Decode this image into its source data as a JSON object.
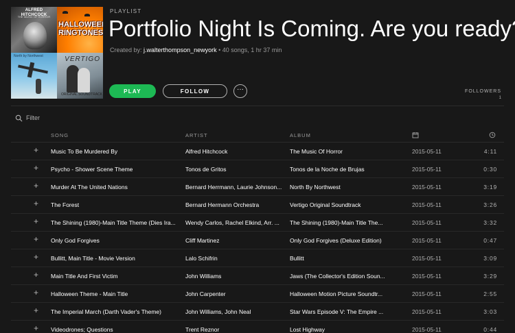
{
  "playlist": {
    "label": "PLAYLIST",
    "title": "Portfolio Night Is Coming. Are you ready?",
    "created_by_prefix": "Created by:",
    "owner": "j.walterthompson_newyork",
    "stats": "• 40 songs, 1 hr 37 min",
    "cover": {
      "tile1_title": "ALFRED HITCHCOCK",
      "tile1_sub": "THE MUSIC OF HORROR",
      "tile2_title": "HALLOWEEN RINGTONES",
      "tile3_label": "North by Northwest",
      "tile4_title": "VERTIGO",
      "tile4_sub": "ORIGINAL SOUNDTRACK"
    }
  },
  "actions": {
    "play_label": "PLAY",
    "follow_label": "FOLLOW",
    "more_label": "···",
    "followers_label": "FOLLOWERS",
    "followers_count": "1"
  },
  "filter": {
    "placeholder": "Filter"
  },
  "table": {
    "headers": {
      "song": "SONG",
      "artist": "ARTIST",
      "album": "ALBUM"
    },
    "rows": [
      {
        "song": "Music To Be Murdered By",
        "artist": "Alfred Hitchcock",
        "album": "The Music Of Horror",
        "date": "2015-05-11",
        "duration": "4:11"
      },
      {
        "song": "Psycho - Shower Scene Theme",
        "artist": "Tonos de Gritos",
        "album": "Tonos de la Noche de Brujas",
        "date": "2015-05-11",
        "duration": "0:30"
      },
      {
        "song": "Murder At The United Nations",
        "artist": "Bernard Herrmann, Laurie Johnson...",
        "album": "North By Northwest",
        "date": "2015-05-11",
        "duration": "3:19"
      },
      {
        "song": "The Forest",
        "artist": "Bernard Hermann Orchestra",
        "album": "Vertigo Original Soundtrack",
        "date": "2015-05-11",
        "duration": "3:26"
      },
      {
        "song": "The Shining (1980)-Main Title Theme (Dies Ira...",
        "artist": "Wendy Carlos, Rachel Elkind, Arr. ...",
        "album": "The Shining (1980)-Main Title The...",
        "date": "2015-05-11",
        "duration": "3:32"
      },
      {
        "song": "Only God Forgives",
        "artist": "Cliff Martinez",
        "album": "Only God Forgives (Deluxe Edition)",
        "date": "2015-05-11",
        "duration": "0:47"
      },
      {
        "song": "Bullitt, Main Title - Movie Version",
        "artist": "Lalo Schifrin",
        "album": "Bullitt",
        "date": "2015-05-11",
        "duration": "3:09"
      },
      {
        "song": "Main Title And First Victim",
        "artist": "John Williams",
        "album": "Jaws (The Collector's Edition Soun...",
        "date": "2015-05-11",
        "duration": "3:29"
      },
      {
        "song": "Halloween Theme - Main Title",
        "artist": "John Carpenter",
        "album": "Halloween Motion Picture Soundtr...",
        "date": "2015-05-11",
        "duration": "2:55"
      },
      {
        "song": "The Imperial March (Darth Vader's Theme)",
        "artist": "John Williams, John Neal",
        "album": "Star Wars Episode V: The Empire ...",
        "date": "2015-05-11",
        "duration": "3:03"
      },
      {
        "song": "Videodrones; Questions",
        "artist": "Trent Reznor",
        "album": "Lost Highway",
        "date": "2015-05-11",
        "duration": "0:44"
      }
    ]
  },
  "colors": {
    "background": "#181818",
    "accent": "#1db954",
    "text_muted": "#b3b3b3"
  }
}
